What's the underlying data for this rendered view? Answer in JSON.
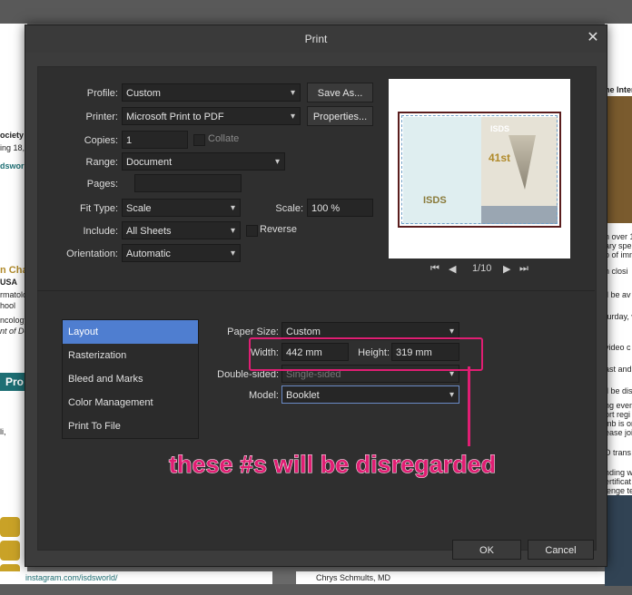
{
  "dialog": {
    "title": "Print"
  },
  "fields": {
    "profile_label": "Profile:",
    "profile_value": "Custom",
    "save_as": "Save As...",
    "printer_label": "Printer:",
    "printer_value": "Microsoft Print to PDF",
    "properties": "Properties...",
    "copies_label": "Copies:",
    "copies_value": "1",
    "collate": "Collate",
    "range_label": "Range:",
    "range_value": "Document",
    "pages_label": "Pages:",
    "pages_value": "",
    "fit_label": "Fit Type:",
    "fit_value": "Scale",
    "scale_label": "Scale:",
    "scale_value": "100 %",
    "include_label": "Include:",
    "include_value": "All Sheets",
    "reverse": "Reverse",
    "orientation_label": "Orientation:",
    "orientation_value": "Automatic"
  },
  "preview": {
    "page_indicator": "1/10",
    "logo_text": "ISDS",
    "issue_number": "41st"
  },
  "categories": [
    "Layout",
    "Rasterization",
    "Bleed and Marks",
    "Color Management",
    "Print To File"
  ],
  "layout": {
    "paper_size_label": "Paper Size:",
    "paper_size_value": "Custom",
    "width_label": "Width:",
    "width_value": "442 mm",
    "height_label": "Height:",
    "height_value": "319 mm",
    "double_sided_label": "Double-sided:",
    "double_sided_value": "Single-sided",
    "model_label": "Model:",
    "model_value": "Booklet"
  },
  "annotation": {
    "text": "these #s will be disregarded",
    "color": "#e01e73"
  },
  "buttons": {
    "ok": "OK",
    "cancel": "Cancel"
  },
  "background": {
    "left_snippets": [
      "ociety f",
      "ing 18,",
      "dswor",
      "n Cha",
      "USA",
      "rmatolo",
      "hool",
      "ncology",
      "nt of De",
      "Pro",
      "li,",
      "instagram.com/isdsworld/"
    ],
    "right_snippets": [
      "he Inter",
      "n over 1",
      "ary spe",
      "p of imm",
      "n closi",
      "ll be av",
      "turday, w",
      "video c",
      "ast and",
      "ll be dis",
      "ng eveni",
      "ort regi",
      "mb is on",
      "ease join",
      "D trans",
      "nding w",
      "ertificat",
      "lenge te"
    ],
    "bottom_name": "Chrys Schmults, MD"
  },
  "colors": {
    "accent": "#4f7ed0",
    "dialog_bg": "#3c3c3c",
    "panel_bg": "#2f2f2f"
  }
}
